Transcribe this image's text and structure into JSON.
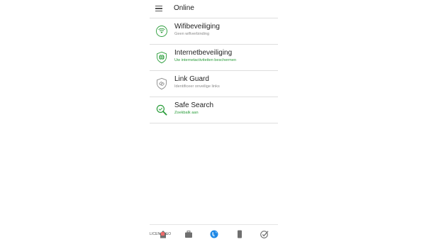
{
  "header": {
    "title": "Online",
    "menu_icon": "menu-icon"
  },
  "items": [
    {
      "title": "Wifibeveiliging",
      "subtitle": "Geen wifiverbinding",
      "subtitle_status": "grey",
      "icon": "wifi-shield-icon"
    },
    {
      "title": "Internetbeveiliging",
      "subtitle": "Uw internetactiviteiten beschermen",
      "subtitle_status": "green",
      "icon": "globe-shield-icon"
    },
    {
      "title": "Link Guard",
      "subtitle": "Identificeer onveilige links",
      "subtitle_status": "grey",
      "icon": "link-shield-icon"
    },
    {
      "title": "Safe Search",
      "subtitle": "Zoekbalk aan",
      "subtitle_status": "green",
      "icon": "search-check-icon"
    }
  ],
  "bottom_nav": [
    {
      "icon": "home-icon"
    },
    {
      "icon": "briefcase-icon"
    },
    {
      "icon": "globe-icon",
      "active": true
    },
    {
      "icon": "phone-device-icon"
    },
    {
      "icon": "check-circle-icon"
    }
  ],
  "watermark": {
    "left": "LICEN",
    "right": "GO"
  },
  "colors": {
    "accent_green": "#2a9d3a",
    "active_blue": "#1e88e5",
    "icon_grey": "#8a8a8a"
  }
}
